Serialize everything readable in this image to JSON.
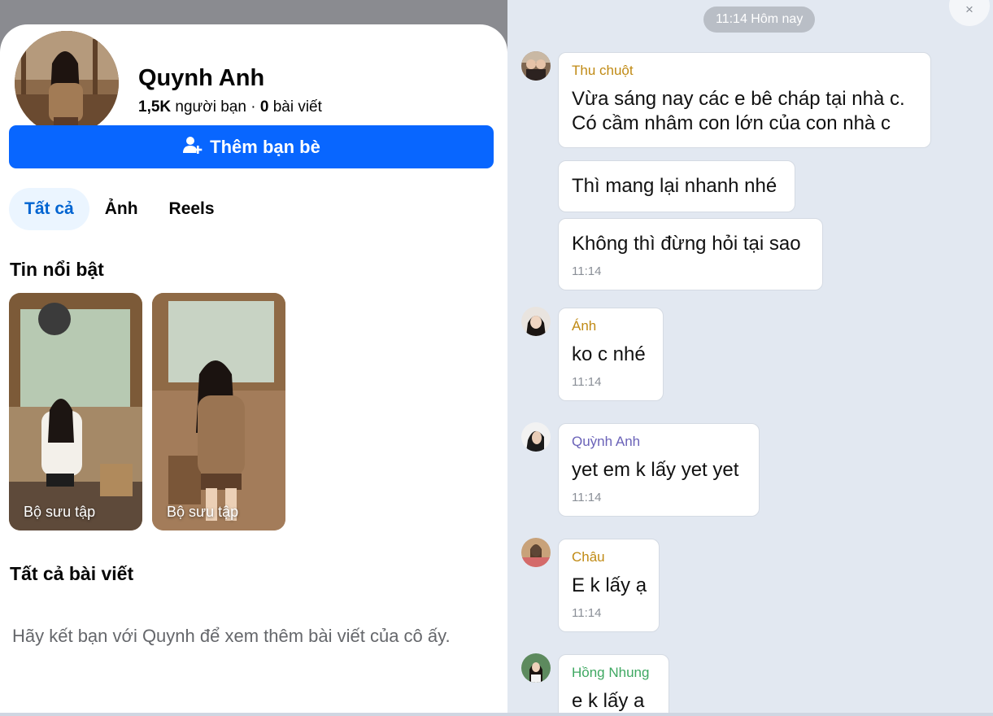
{
  "profile": {
    "name": "Quynh Anh",
    "friends_count": "1,5K",
    "friends_label": "người bạn",
    "separator": "·",
    "posts_count": "0",
    "posts_label": "bài viết",
    "add_friend_label": "Thêm bạn bè",
    "tabs": [
      {
        "label": "Tất cả",
        "active": true
      },
      {
        "label": "Ảnh",
        "active": false
      },
      {
        "label": "Reels",
        "active": false
      }
    ],
    "highlights_title": "Tin nổi bật",
    "highlights": [
      {
        "label": "Bộ sưu tập"
      },
      {
        "label": "Bộ sưu tập"
      }
    ],
    "all_posts_title": "Tất cả bài viết",
    "posts_note": "Hãy kết bạn với Quynh để xem thêm bài viết của cô ấy."
  },
  "chat": {
    "time_header": "11:14 Hôm nay",
    "close_icon": "×",
    "messages": [
      {
        "sender": "Thu chuột",
        "sender_color": "#c08a14",
        "lines": [
          "Vừa sáng nay các e bê cháp tại nhà c.",
          "Có cầm nhâm con lớn của con nhà c"
        ],
        "time": ""
      },
      {
        "sender": "",
        "lines": [
          "Thì mang lại nhanh nhé"
        ],
        "time": ""
      },
      {
        "sender": "",
        "lines": [
          "Không thì đừng hỏi tại sao"
        ],
        "time": "11:14"
      },
      {
        "sender": "Ánh",
        "sender_color": "#c08a14",
        "lines": [
          "ko c nhé"
        ],
        "time": "11:14"
      },
      {
        "sender": "Quỳnh Anh",
        "sender_color": "#6a62b8",
        "lines": [
          "yet em k lấy yet yet"
        ],
        "time": "11:14"
      },
      {
        "sender": "Châu",
        "sender_color": "#c08a14",
        "lines": [
          "E k lấy ạ"
        ],
        "time": "11:14"
      },
      {
        "sender": "Hồng Nhung",
        "sender_color": "#3fa862",
        "lines": [
          "e k lấy a"
        ],
        "time": ""
      }
    ]
  }
}
